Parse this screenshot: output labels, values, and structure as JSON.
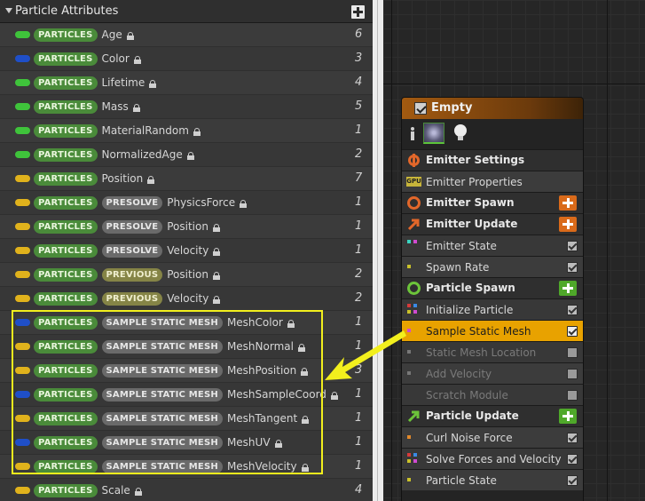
{
  "panel": {
    "title": "Particle Attributes",
    "add_icon": "plus-icon",
    "lock_icon": "lock-icon",
    "rows": [
      {
        "color": "#3fc33b",
        "tags": [
          {
            "kind": "particles",
            "text": "PARTICLES"
          }
        ],
        "name": "Age",
        "count": "6"
      },
      {
        "color": "#1f4fc8",
        "tags": [
          {
            "kind": "particles",
            "text": "PARTICLES"
          }
        ],
        "name": "Color",
        "count": "3"
      },
      {
        "color": "#3fc33b",
        "tags": [
          {
            "kind": "particles",
            "text": "PARTICLES"
          }
        ],
        "name": "Lifetime",
        "count": "4"
      },
      {
        "color": "#3fc33b",
        "tags": [
          {
            "kind": "particles",
            "text": "PARTICLES"
          }
        ],
        "name": "Mass",
        "count": "5"
      },
      {
        "color": "#3fc33b",
        "tags": [
          {
            "kind": "particles",
            "text": "PARTICLES"
          }
        ],
        "name": "MaterialRandom",
        "count": "1"
      },
      {
        "color": "#3fc33b",
        "tags": [
          {
            "kind": "particles",
            "text": "PARTICLES"
          }
        ],
        "name": "NormalizedAge",
        "count": "2"
      },
      {
        "color": "#e0b21c",
        "tags": [
          {
            "kind": "particles",
            "text": "PARTICLES"
          }
        ],
        "name": "Position",
        "count": "7"
      },
      {
        "color": "#e0b21c",
        "tags": [
          {
            "kind": "particles",
            "text": "PARTICLES"
          },
          {
            "kind": "presolve",
            "text": "PRESOLVE"
          }
        ],
        "name": "PhysicsForce",
        "count": "1"
      },
      {
        "color": "#e0b21c",
        "tags": [
          {
            "kind": "particles",
            "text": "PARTICLES"
          },
          {
            "kind": "presolve",
            "text": "PRESOLVE"
          }
        ],
        "name": "Position",
        "count": "1"
      },
      {
        "color": "#e0b21c",
        "tags": [
          {
            "kind": "particles",
            "text": "PARTICLES"
          },
          {
            "kind": "presolve",
            "text": "PRESOLVE"
          }
        ],
        "name": "Velocity",
        "count": "1"
      },
      {
        "color": "#e0b21c",
        "tags": [
          {
            "kind": "particles",
            "text": "PARTICLES"
          },
          {
            "kind": "previous",
            "text": "PREVIOUS"
          }
        ],
        "name": "Position",
        "count": "2"
      },
      {
        "color": "#e0b21c",
        "tags": [
          {
            "kind": "particles",
            "text": "PARTICLES"
          },
          {
            "kind": "previous",
            "text": "PREVIOUS"
          }
        ],
        "name": "Velocity",
        "count": "2"
      },
      {
        "color": "#1f4fc8",
        "tags": [
          {
            "kind": "particles",
            "text": "PARTICLES"
          },
          {
            "kind": "mesh",
            "text": "SAMPLE STATIC MESH"
          }
        ],
        "name": "MeshColor",
        "count": "1"
      },
      {
        "color": "#e0b21c",
        "tags": [
          {
            "kind": "particles",
            "text": "PARTICLES"
          },
          {
            "kind": "mesh",
            "text": "SAMPLE STATIC MESH"
          }
        ],
        "name": "MeshNormal",
        "count": "1"
      },
      {
        "color": "#e0b21c",
        "tags": [
          {
            "kind": "particles",
            "text": "PARTICLES"
          },
          {
            "kind": "mesh",
            "text": "SAMPLE STATIC MESH"
          }
        ],
        "name": "MeshPosition",
        "count": "3"
      },
      {
        "color": "#1f4fc8",
        "tags": [
          {
            "kind": "particles",
            "text": "PARTICLES"
          },
          {
            "kind": "mesh",
            "text": "SAMPLE STATIC MESH"
          }
        ],
        "name": "MeshSampleCoord",
        "count": "1"
      },
      {
        "color": "#e0b21c",
        "tags": [
          {
            "kind": "particles",
            "text": "PARTICLES"
          },
          {
            "kind": "mesh",
            "text": "SAMPLE STATIC MESH"
          }
        ],
        "name": "MeshTangent",
        "count": "1"
      },
      {
        "color": "#1f4fc8",
        "tags": [
          {
            "kind": "particles",
            "text": "PARTICLES"
          },
          {
            "kind": "mesh",
            "text": "SAMPLE STATIC MESH"
          }
        ],
        "name": "MeshUV",
        "count": "1"
      },
      {
        "color": "#e0b21c",
        "tags": [
          {
            "kind": "particles",
            "text": "PARTICLES"
          },
          {
            "kind": "mesh",
            "text": "SAMPLE STATIC MESH"
          }
        ],
        "name": "MeshVelocity",
        "count": "1"
      },
      {
        "color": "#e0b21c",
        "tags": [
          {
            "kind": "particles",
            "text": "PARTICLES"
          }
        ],
        "name": "Scale",
        "count": "4"
      }
    ]
  },
  "annotation": {
    "highlight_color": "#f2ef1d",
    "arrow_color": "#f2ef1d"
  },
  "node": {
    "title": "Empty",
    "enabled": true,
    "header_color": "#a35a10",
    "icons": [
      "person-icon",
      "thumbnail-icon",
      "light-bulb-icon"
    ],
    "items": [
      {
        "kind": "head",
        "label": "Emitter Settings",
        "icon": "emitter-settings-icon",
        "icon_color": "#e2672a",
        "add": false
      },
      {
        "kind": "mod",
        "label": "Emitter Properties",
        "icon": "gpu-icon",
        "badge": "GPU",
        "checkbox": false
      },
      {
        "kind": "head",
        "label": "Emitter Spawn",
        "icon": "ring-icon",
        "icon_color": "#e2672a",
        "add": true,
        "add_color": "#d96a1a"
      },
      {
        "kind": "head",
        "label": "Emitter Update",
        "icon": "arrow-up-right-icon",
        "icon_color": "#e2672a",
        "add": true,
        "add_color": "#d96a1a"
      },
      {
        "kind": "mod",
        "label": "Emitter State",
        "dot_colors": [
          "#3ad3c0",
          "#d14ad1"
        ],
        "checkbox": true,
        "checked": true
      },
      {
        "kind": "mod",
        "label": "Spawn Rate",
        "dot_colors": [
          "#c9c12a"
        ],
        "checkbox": true,
        "checked": true
      },
      {
        "kind": "head",
        "label": "Particle Spawn",
        "icon": "ring-icon",
        "icon_color": "#6cc43a",
        "add": true,
        "add_color": "#4fa82a"
      },
      {
        "kind": "mod",
        "label": "Initialize Particle",
        "dot_colors": [
          "#d63a3a",
          "#3a8ae6",
          "#c9c12a",
          "#d14ad1"
        ],
        "checkbox": true,
        "checked": true
      },
      {
        "kind": "mod",
        "label": "Sample Static Mesh",
        "dot_colors": [
          "#d14ad1"
        ],
        "checkbox": true,
        "checked": true,
        "selected": true
      },
      {
        "kind": "mod",
        "label": "Static Mesh Location",
        "dot_colors": [
          "#777777"
        ],
        "checkbox": true,
        "checked": false,
        "disabled": true
      },
      {
        "kind": "mod",
        "label": "Add Velocity",
        "dot_colors": [
          "#777777"
        ],
        "checkbox": true,
        "checked": false,
        "disabled": true
      },
      {
        "kind": "mod",
        "label": "Scratch Module",
        "dot_colors": [],
        "checkbox": true,
        "checked": false,
        "disabled": true
      },
      {
        "kind": "head",
        "label": "Particle Update",
        "icon": "arrow-up-right-icon",
        "icon_color": "#6cc43a",
        "add": true,
        "add_color": "#4fa82a"
      },
      {
        "kind": "mod",
        "label": "Curl Noise Force",
        "dot_colors": [
          "#e2892a"
        ],
        "checkbox": true,
        "checked": true
      },
      {
        "kind": "mod",
        "label": "Solve Forces and Velocity",
        "dot_colors": [
          "#d63a3a",
          "#3a8ae6",
          "#c9c12a",
          "#d14ad1"
        ],
        "checkbox": true,
        "checked": true
      },
      {
        "kind": "mod",
        "label": "Particle State",
        "dot_colors": [
          "#c9c12a"
        ],
        "checkbox": true,
        "checked": true
      }
    ]
  }
}
